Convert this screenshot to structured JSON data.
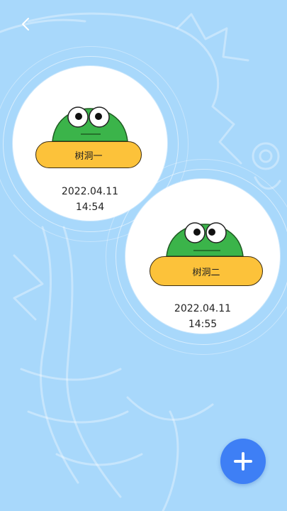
{
  "nav": {
    "back_icon": "chevron-left-icon"
  },
  "tree_holes": [
    {
      "name": "树洞一",
      "date": "2022.04.11",
      "time": "14:54",
      "icon": "frog-icon"
    },
    {
      "name": "树洞二",
      "date": "2022.04.11",
      "time": "14:55",
      "icon": "frog-icon"
    }
  ],
  "fab": {
    "icon": "plus-icon"
  },
  "colors": {
    "background": "#a8d8fb",
    "card": "#ffffff",
    "pill": "#fcc23a",
    "frog_green": "#3bb44a",
    "fab": "#3e7ff5"
  }
}
